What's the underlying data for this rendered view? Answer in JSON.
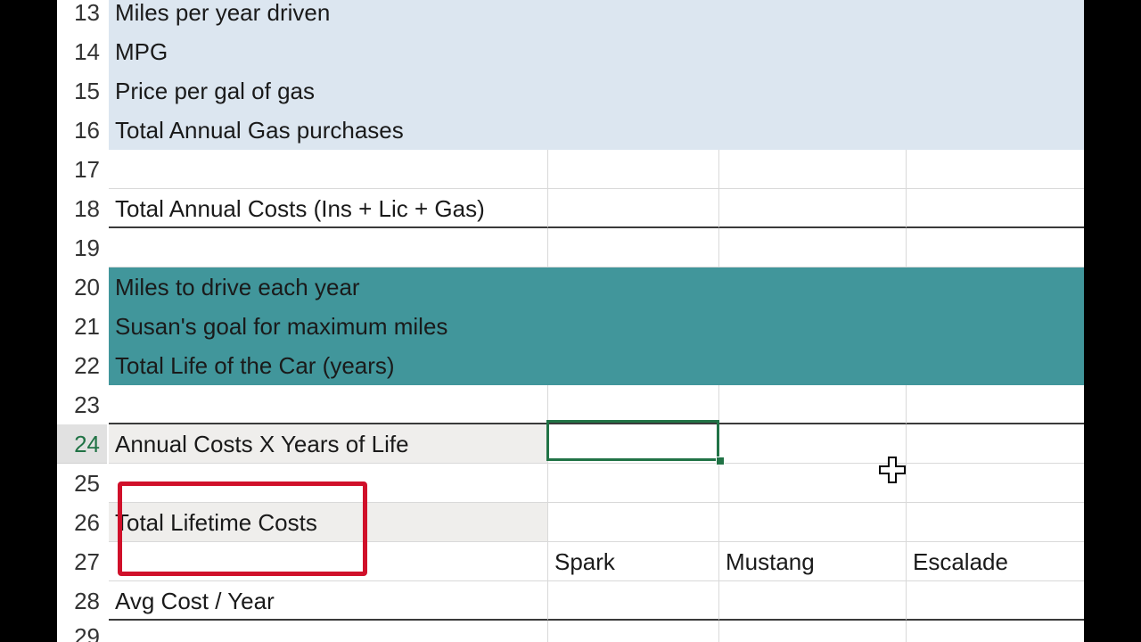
{
  "rows": [
    {
      "num": "13",
      "label": "Miles per year driven",
      "style": "blue"
    },
    {
      "num": "14",
      "label": "MPG",
      "style": "blue"
    },
    {
      "num": "15",
      "label": "Price per gal of gas",
      "style": "blue"
    },
    {
      "num": "16",
      "label": "Total Annual Gas purchases",
      "style": "blue"
    },
    {
      "num": "17",
      "label": "",
      "style": "plain"
    },
    {
      "num": "18",
      "label": "Total Annual Costs (Ins + Lic + Gas)",
      "style": "plain"
    },
    {
      "num": "19",
      "label": "",
      "style": "plain"
    },
    {
      "num": "20",
      "label": "Miles to drive each year",
      "style": "teal"
    },
    {
      "num": "21",
      "label": "Susan's goal for maximum miles",
      "style": "teal"
    },
    {
      "num": "22",
      "label": "Total Life of the Car (years)",
      "style": "teal"
    },
    {
      "num": "23",
      "label": "",
      "style": "plain"
    },
    {
      "num": "24",
      "label": "Annual Costs X Years of Life",
      "style": "plain"
    },
    {
      "num": "25",
      "label": "",
      "style": "plain"
    },
    {
      "num": "26",
      "label": "Total Lifetime Costs",
      "style": "plain"
    },
    {
      "num": "27",
      "label": "",
      "style": "plain",
      "b": "Spark",
      "c": "Mustang",
      "d": "Escalade"
    },
    {
      "num": "28",
      "label": "Avg Cost / Year",
      "style": "plain"
    },
    {
      "num": "29",
      "label": "",
      "style": "plain"
    }
  ],
  "active_row": "24",
  "colors": {
    "blue_fill": "#dce6f0",
    "teal_fill": "#41969b",
    "selection": "#217346",
    "annotation": "#d0102a"
  }
}
